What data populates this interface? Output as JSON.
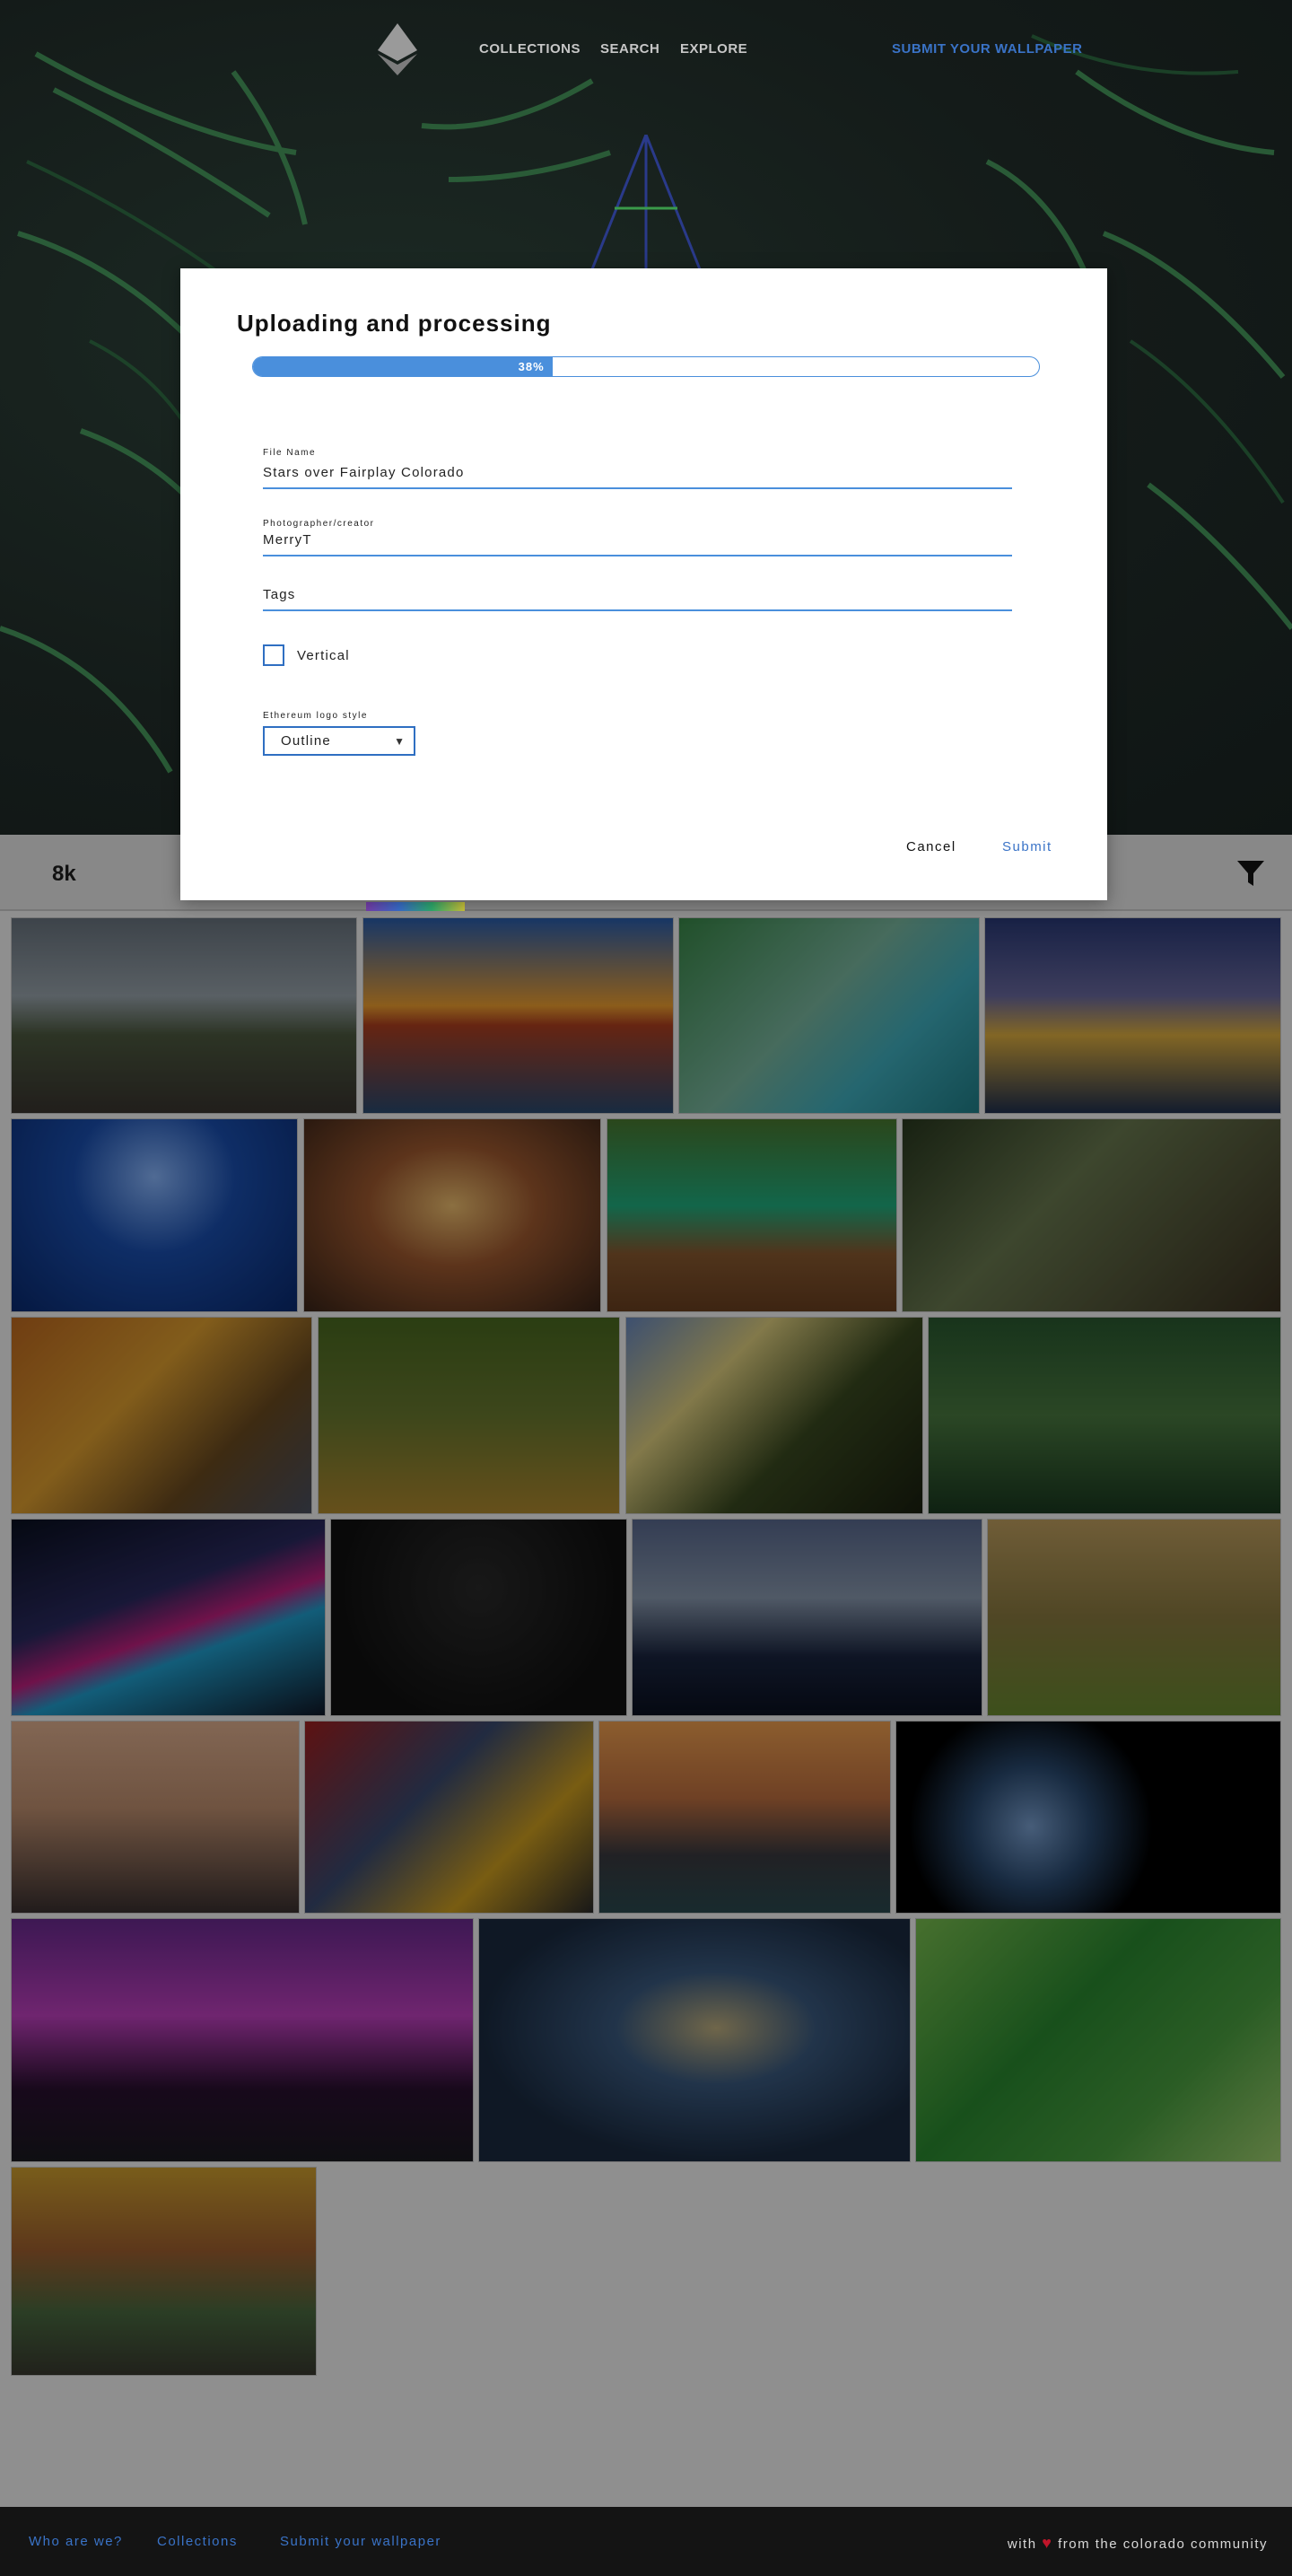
{
  "nav": {
    "links": [
      "COLLECTIONS",
      "SEARCH",
      "EXPLORE"
    ],
    "submit": "SUBMIT YOUR WALLPAPER"
  },
  "filterbar": {
    "count": "8k"
  },
  "modal": {
    "title": "Uploading and processing",
    "progress": {
      "percent": 38,
      "label": "38%"
    },
    "file_name": {
      "label": "File Name",
      "value": "Stars over Fairplay Colorado"
    },
    "photographer": {
      "label": "Photographer/creator",
      "value": "MerryT"
    },
    "tags": {
      "label": "",
      "placeholder": "Tags"
    },
    "vertical": {
      "label": "Vertical",
      "checked": false
    },
    "logo_style": {
      "label": "Ethereum logo style",
      "value": "Outline"
    },
    "cancel": "Cancel",
    "submit": "Submit"
  },
  "gallery": {
    "tiles": [
      {
        "name": "road-mountains-storm"
      },
      {
        "name": "golden-gate-sunset"
      },
      {
        "name": "tropical-boat-cliffs"
      },
      {
        "name": "sea-sunset-clouds"
      },
      {
        "name": "underwater-sun"
      },
      {
        "name": "sea-cave-sunset"
      },
      {
        "name": "green-lagoon-boardwalk"
      },
      {
        "name": "forest-waterfall"
      },
      {
        "name": "autumn-trees-road"
      },
      {
        "name": "tree-lined-path"
      },
      {
        "name": "sunlit-forest"
      },
      {
        "name": "misty-green-forest"
      },
      {
        "name": "abstract-color-waves"
      },
      {
        "name": "black-cat-blue-eyes"
      },
      {
        "name": "misty-hills-bird"
      },
      {
        "name": "lambs-meadow"
      },
      {
        "name": "blue-mosque"
      },
      {
        "name": "times-square"
      },
      {
        "name": "prague-bridges"
      },
      {
        "name": "earth-moon-space"
      },
      {
        "name": "bridge-night-purple"
      },
      {
        "name": "galaxy"
      },
      {
        "name": "pine-needles-dew"
      },
      {
        "name": "autumn-mill"
      }
    ]
  },
  "footer": {
    "links": [
      "Who are we?",
      "Collections",
      "Submit your wallpaper"
    ],
    "credit_pre": "with",
    "credit_post": "from the colorado community"
  },
  "colors": {
    "accent": "#4a8fdc",
    "link_blue": "#3a73c7",
    "heart": "#c0152a"
  }
}
